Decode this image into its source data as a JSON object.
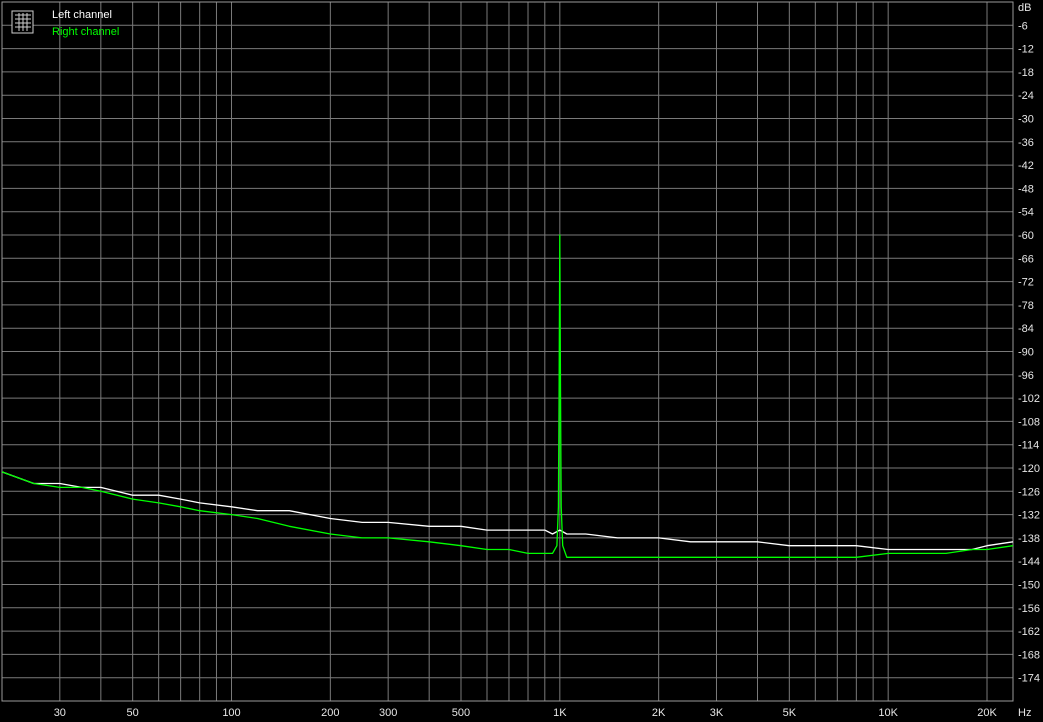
{
  "chart_data": {
    "type": "line",
    "xlabel": "Hz",
    "ylabel": "dB",
    "xscale": "log",
    "xlim": [
      20,
      24000
    ],
    "ylim": [
      -180,
      0
    ],
    "grid": true,
    "legend_position": "top-left",
    "x_ticks": [
      {
        "value": 30,
        "label": "30"
      },
      {
        "value": 50,
        "label": "50"
      },
      {
        "value": 100,
        "label": "100"
      },
      {
        "value": 200,
        "label": "200"
      },
      {
        "value": 300,
        "label": "300"
      },
      {
        "value": 500,
        "label": "500"
      },
      {
        "value": 1000,
        "label": "1K"
      },
      {
        "value": 2000,
        "label": "2K"
      },
      {
        "value": 3000,
        "label": "3K"
      },
      {
        "value": 5000,
        "label": "5K"
      },
      {
        "value": 10000,
        "label": "10K"
      },
      {
        "value": 20000,
        "label": "20K"
      }
    ],
    "y_ticks": [
      -6,
      -12,
      -18,
      -24,
      -30,
      -36,
      -42,
      -48,
      -54,
      -60,
      -66,
      -72,
      -78,
      -84,
      -90,
      -96,
      -102,
      -108,
      -114,
      -120,
      -126,
      -132,
      -138,
      -144,
      -150,
      -156,
      -162,
      -168,
      -174
    ],
    "series": [
      {
        "name": "Left channel",
        "color": "#ffffff",
        "x": [
          20,
          25,
          30,
          35,
          40,
          50,
          60,
          70,
          80,
          100,
          120,
          150,
          200,
          250,
          300,
          400,
          500,
          600,
          700,
          800,
          900,
          950,
          1000,
          1050,
          1100,
          1200,
          1500,
          2000,
          2500,
          3000,
          4000,
          5000,
          6000,
          8000,
          10000,
          12000,
          15000,
          18000,
          20000,
          24000
        ],
        "y": [
          -121,
          -124,
          -124,
          -125,
          -125,
          -127,
          -127,
          -128,
          -129,
          -130,
          -131,
          -131,
          -133,
          -134,
          -134,
          -135,
          -135,
          -136,
          -136,
          -136,
          -136,
          -137,
          -136,
          -137,
          -137,
          -137,
          -138,
          -138,
          -139,
          -139,
          -139,
          -140,
          -140,
          -140,
          -141,
          -141,
          -141,
          -141,
          -140,
          -139
        ]
      },
      {
        "name": "Right channel",
        "color": "#00ff00",
        "x": [
          20,
          25,
          30,
          35,
          40,
          50,
          60,
          70,
          80,
          100,
          120,
          150,
          200,
          250,
          300,
          400,
          500,
          600,
          700,
          800,
          900,
          950,
          980,
          990,
          995,
          1000,
          1005,
          1010,
          1020,
          1050,
          1100,
          1200,
          1500,
          2000,
          2500,
          3000,
          4000,
          5000,
          6000,
          8000,
          10000,
          12000,
          15000,
          18000,
          20000,
          24000
        ],
        "y": [
          -121,
          -124,
          -125,
          -125,
          -126,
          -128,
          -129,
          -130,
          -131,
          -132,
          -133,
          -135,
          -137,
          -138,
          -138,
          -139,
          -140,
          -141,
          -141,
          -142,
          -142,
          -142,
          -140,
          -130,
          -100,
          -60,
          -100,
          -130,
          -140,
          -143,
          -143,
          -143,
          -143,
          -143,
          -143,
          -143,
          -143,
          -143,
          -143,
          -143,
          -142,
          -142,
          -142,
          -141,
          -141,
          -140
        ]
      }
    ]
  }
}
